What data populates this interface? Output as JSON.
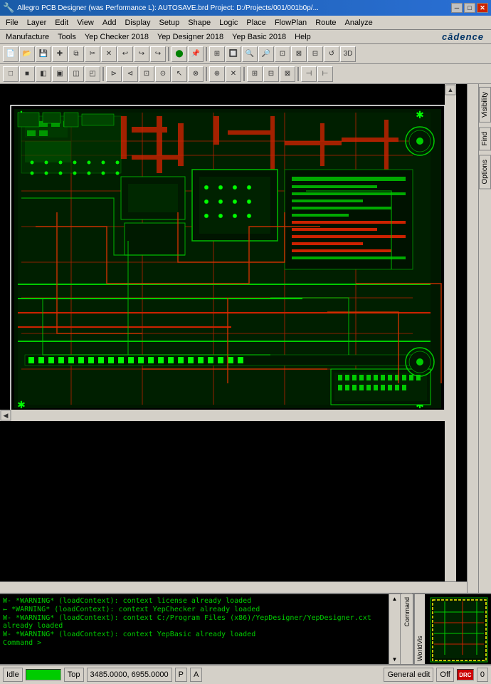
{
  "titlebar": {
    "title": "Allegro PCB Designer (was Performance L): AUTOSAVE.brd  Project: D:/Projects/001/001b0p/...",
    "app_icon": "pcb-icon",
    "minimize_label": "─",
    "restore_label": "□",
    "close_label": "✕"
  },
  "menubar1": {
    "items": [
      {
        "label": "File",
        "id": "file"
      },
      {
        "label": "Layer",
        "id": "layer"
      },
      {
        "label": "Edit",
        "id": "edit"
      },
      {
        "label": "View",
        "id": "view"
      },
      {
        "label": "Add",
        "id": "add"
      },
      {
        "label": "Display",
        "id": "display"
      },
      {
        "label": "Setup",
        "id": "setup"
      },
      {
        "label": "Shape",
        "id": "shape"
      },
      {
        "label": "Logic",
        "id": "logic"
      },
      {
        "label": "Place",
        "id": "place"
      },
      {
        "label": "FlowPlan",
        "id": "flowplan"
      },
      {
        "label": "Route",
        "id": "route"
      },
      {
        "label": "Analyze",
        "id": "analyze"
      }
    ]
  },
  "menubar2": {
    "items": [
      {
        "label": "Manufacture",
        "id": "manufacture"
      },
      {
        "label": "Tools",
        "id": "tools"
      },
      {
        "label": "Yep Checker 2018",
        "id": "yepchecker"
      },
      {
        "label": "Yep Designer 2018",
        "id": "yepdesigner"
      },
      {
        "label": "Yep Basic 2018",
        "id": "yepbasic"
      },
      {
        "label": "Help",
        "id": "help"
      }
    ],
    "logo": "cadence"
  },
  "toolbar1": {
    "buttons": [
      {
        "id": "new",
        "icon": "📄",
        "tooltip": "New"
      },
      {
        "id": "open",
        "icon": "📂",
        "tooltip": "Open"
      },
      {
        "id": "save",
        "icon": "💾",
        "tooltip": "Save"
      },
      {
        "id": "crosshair",
        "icon": "✚",
        "tooltip": "Crosshair"
      },
      {
        "id": "copy",
        "icon": "⧉",
        "tooltip": "Copy"
      },
      {
        "id": "cut",
        "icon": "✂",
        "tooltip": "Cut"
      },
      {
        "id": "close2",
        "icon": "✕",
        "tooltip": "Close"
      },
      {
        "id": "undo",
        "icon": "↩",
        "tooltip": "Undo"
      },
      {
        "id": "redo1",
        "icon": "↪",
        "tooltip": "Redo"
      },
      {
        "id": "redo2",
        "icon": "↪",
        "tooltip": "Redo2"
      },
      {
        "id": "sep1",
        "type": "separator"
      },
      {
        "id": "circle",
        "icon": "⬤",
        "tooltip": "Circle",
        "color": "green"
      },
      {
        "id": "pin",
        "icon": "📌",
        "tooltip": "Pin"
      },
      {
        "id": "sep2",
        "type": "separator"
      },
      {
        "id": "zoom1",
        "icon": "⊞",
        "tooltip": "Zoom In"
      },
      {
        "id": "zoom2",
        "icon": "🔲",
        "tooltip": "Zoom"
      },
      {
        "id": "zoom3",
        "icon": "🔍",
        "tooltip": "Zoom In"
      },
      {
        "id": "zoom4",
        "icon": "🔎",
        "tooltip": "Zoom Out"
      },
      {
        "id": "zoom5",
        "icon": "⊡",
        "tooltip": "Zoom Fit"
      },
      {
        "id": "zoom6",
        "icon": "⊠",
        "tooltip": "Zoom Prev"
      },
      {
        "id": "zoom7",
        "icon": "⊟",
        "tooltip": "Zoom Next"
      },
      {
        "id": "zoom8",
        "icon": "↺",
        "tooltip": "Refresh"
      },
      {
        "id": "d3",
        "icon": "3D",
        "tooltip": "3D View"
      }
    ]
  },
  "toolbar2": {
    "buttons": [
      {
        "id": "t1",
        "icon": "□",
        "tooltip": "t1"
      },
      {
        "id": "t2",
        "icon": "■",
        "tooltip": "t2"
      },
      {
        "id": "t3",
        "icon": "◧",
        "tooltip": "t3"
      },
      {
        "id": "t4",
        "icon": "▣",
        "tooltip": "t4"
      },
      {
        "id": "t5",
        "icon": "◫",
        "tooltip": "t5"
      },
      {
        "id": "t6",
        "icon": "◰",
        "tooltip": "t6"
      },
      {
        "id": "sep1",
        "type": "separator"
      },
      {
        "id": "t7",
        "icon": "⊳",
        "tooltip": "t7"
      },
      {
        "id": "t8",
        "icon": "⊲",
        "tooltip": "t8"
      },
      {
        "id": "t9",
        "icon": "⊡",
        "tooltip": "t9"
      },
      {
        "id": "t10",
        "icon": "⊙",
        "tooltip": "t10"
      },
      {
        "id": "t11",
        "icon": "↖",
        "tooltip": "cursor"
      },
      {
        "id": "t12",
        "icon": "⊗",
        "tooltip": "t12"
      },
      {
        "id": "sep2",
        "type": "separator"
      },
      {
        "id": "t13",
        "icon": "⊕",
        "tooltip": "t13"
      },
      {
        "id": "t14",
        "icon": "✕",
        "tooltip": "t14"
      },
      {
        "id": "sep3",
        "type": "separator"
      },
      {
        "id": "t15",
        "icon": "⊞",
        "tooltip": "t15"
      },
      {
        "id": "t16",
        "icon": "⊟",
        "tooltip": "t16"
      },
      {
        "id": "t17",
        "icon": "⊠",
        "tooltip": "t17"
      },
      {
        "id": "sep4",
        "type": "separator"
      },
      {
        "id": "t18",
        "icon": "⊣",
        "tooltip": "t18"
      },
      {
        "id": "t19",
        "icon": "⊢",
        "tooltip": "t19"
      }
    ]
  },
  "right_panel": {
    "tabs": [
      {
        "label": "Visibility",
        "id": "visibility"
      },
      {
        "label": "Find",
        "id": "find"
      },
      {
        "label": "Options",
        "id": "options"
      }
    ]
  },
  "console": {
    "lines": [
      {
        "type": "warning",
        "text": "W- *WARNING* (loadContext): context license already loaded"
      },
      {
        "type": "info",
        "text": "← *WARNING* (loadContext): context YepChecker already loaded"
      },
      {
        "type": "warning",
        "text": "W- *WARNING* (loadContext): context C:/Program Files (x86)/YepDesigner/YepDesigner.cxt already loaded"
      },
      {
        "type": "warning",
        "text": "W- *WARNING* (loadContext): context YepBasic already loaded"
      },
      {
        "type": "prompt",
        "text": "Command >"
      }
    ],
    "side_label": "Command",
    "worldview_label": "WorldVis"
  },
  "statusbar": {
    "status_text": "Idle",
    "status_indicator": "green",
    "layer": "Top",
    "coordinates": "3485.0000, 6955.0000",
    "p_flag": "P",
    "a_flag": "A",
    "dash": "-",
    "mode": "General edit",
    "off_label": "Off",
    "highlight": "DRC",
    "number": "0"
  }
}
